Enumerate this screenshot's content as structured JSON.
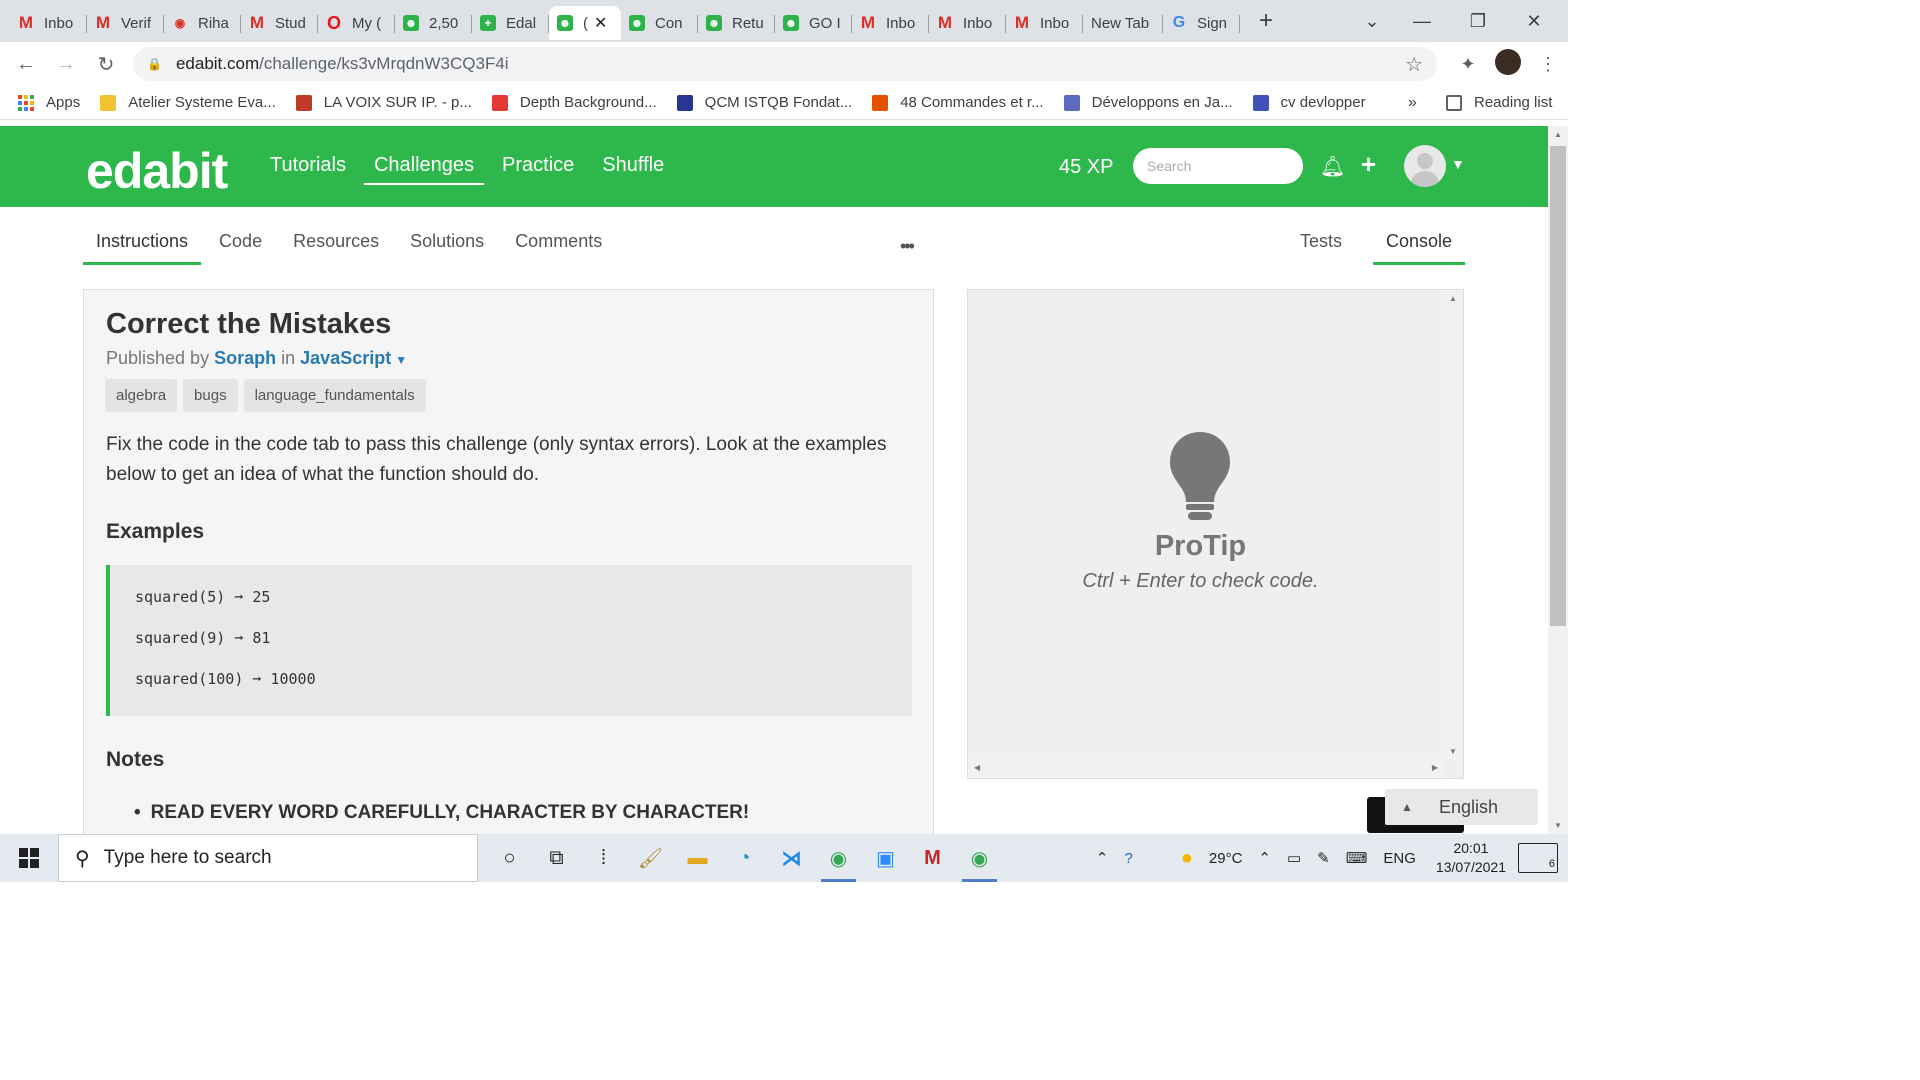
{
  "browser": {
    "tabs": [
      {
        "label": "Inbo",
        "icon": "gmail"
      },
      {
        "label": "Verif",
        "icon": "gmail"
      },
      {
        "label": "Riha",
        "icon": "riha"
      },
      {
        "label": "Stud",
        "icon": "gmail"
      },
      {
        "label": "My (",
        "icon": "opera"
      },
      {
        "label": "2,50",
        "icon": "edabit"
      },
      {
        "label": "Edal",
        "icon": "edabit-plus"
      },
      {
        "label": "(",
        "icon": "edabit",
        "active": true
      },
      {
        "label": "Con",
        "icon": "edabit"
      },
      {
        "label": "Retu",
        "icon": "edabit"
      },
      {
        "label": "GO I",
        "icon": "edabit"
      },
      {
        "label": "Inbo",
        "icon": "gmail"
      },
      {
        "label": "Inbo",
        "icon": "gmail"
      },
      {
        "label": "Inbo",
        "icon": "gmail"
      },
      {
        "label": "New Tab",
        "icon": "none"
      },
      {
        "label": "Sign",
        "icon": "google"
      }
    ],
    "url_host": "edabit.com",
    "url_path": "/challenge/ks3vMrqdnW3CQ3F4i",
    "bookmarks": [
      {
        "label": "Apps",
        "color": "#4285f4"
      },
      {
        "label": "Atelier Systeme Eva...",
        "color": "#f4c430"
      },
      {
        "label": "LA VOIX SUR IP. - p...",
        "color": "#c0392b"
      },
      {
        "label": "Depth Background...",
        "color": "#e53935"
      },
      {
        "label": "QCM ISTQB Fondat...",
        "color": "#283593"
      },
      {
        "label": "48 Commandes et r...",
        "color": "#e65100"
      },
      {
        "label": "Développons en Ja...",
        "color": "#5c6bc0"
      },
      {
        "label": "cv devlopper",
        "color": "#3f51b5"
      }
    ],
    "more_bookmarks": "»",
    "reading_list": "Reading list"
  },
  "site": {
    "logo": "edabit",
    "nav": [
      "Tutorials",
      "Challenges",
      "Practice",
      "Shuffle"
    ],
    "active_nav": "Challenges",
    "xp": "45 XP",
    "search_placeholder": "Search",
    "brand_color": "#2eb84b"
  },
  "challenge": {
    "tabs": [
      "Instructions",
      "Code",
      "Resources",
      "Solutions",
      "Comments"
    ],
    "more": "•••",
    "right_tabs": [
      "Tests",
      "Console"
    ],
    "title": "Correct the Mistakes",
    "published_by_prefix": "Published by",
    "author": "Soraph",
    "in": "in",
    "language": "JavaScript",
    "tags": [
      "algebra",
      "bugs",
      "language_fundamentals"
    ],
    "description": "Fix the code in the code tab to pass this challenge (only syntax errors). Look at the examples below to get an idea of what the function should do.",
    "examples_heading": "Examples",
    "examples": [
      "squared(5) ➞ 25",
      "squared(9) ➞ 81",
      "squared(100) ➞ 10000"
    ],
    "notes_heading": "Notes",
    "notes": [
      "READ EVERY WORD CAREFULLY, CHARACTER BY CHARACTER!"
    ]
  },
  "console": {
    "protip_title": "ProTip",
    "protip_text": "Ctrl + Enter to check code."
  },
  "language_selector": "English",
  "taskbar": {
    "search_placeholder": "Type here to search",
    "temperature": "29°C",
    "lang": "ENG",
    "time": "20:01",
    "date": "13/07/2021",
    "notifications": "6"
  }
}
